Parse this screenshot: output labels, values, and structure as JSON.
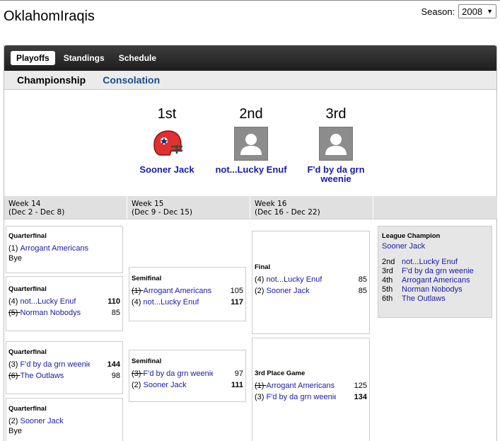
{
  "app": {
    "title": "OklahomIraqis"
  },
  "season": {
    "label": "Season:",
    "value": "2008"
  },
  "nav": {
    "tabs": [
      "Playoffs",
      "Standings",
      "Schedule"
    ]
  },
  "subnav": {
    "tabs": [
      "Championship",
      "Consolation"
    ]
  },
  "podium": [
    {
      "rank": "1st",
      "team": "Sooner Jack",
      "avatar": "helmet-icon"
    },
    {
      "rank": "2nd",
      "team": "not...Lucky Enuf",
      "avatar": "person-icon"
    },
    {
      "rank": "3rd",
      "team": "F'd by da grn weenie",
      "avatar": "person-icon"
    }
  ],
  "weeks": [
    {
      "name": "Week 14",
      "dates": "(Dec 2 - Dec 8)"
    },
    {
      "name": "Week 15",
      "dates": "(Dec 9 - Dec 15)"
    },
    {
      "name": "Week 16",
      "dates": "(Dec 16 - Dec 22)"
    }
  ],
  "matches": {
    "q1": {
      "title": "Quarterfinal",
      "seed": "(1)",
      "team": "Arrogant Americans",
      "bye": "Bye"
    },
    "q2": {
      "title": "Quarterfinal",
      "a_seed": "(4)",
      "a_team": "not...Lucky Enuf",
      "a_score": "110",
      "b_seed": "(5)",
      "b_team": "Norman Nobodys",
      "b_score": "85"
    },
    "q3": {
      "title": "Quarterfinal",
      "a_seed": "(3)",
      "a_team": "F'd by da grn weenie",
      "a_score": "144",
      "b_seed": "(6)",
      "b_team": "The Outlaws",
      "b_score": "98"
    },
    "q4": {
      "title": "Quarterfinal",
      "seed": "(2)",
      "team": "Sooner Jack",
      "bye": "Bye"
    },
    "s1": {
      "title": "Semifinal",
      "a_seed": "(1)",
      "a_team": "Arrogant Americans",
      "a_score": "105",
      "b_seed": "(4)",
      "b_team": "not...Lucky Enuf",
      "b_score": "117"
    },
    "s2": {
      "title": "Semifinal",
      "a_seed": "(3)",
      "a_team": "F'd by da grn weenie",
      "a_score": "97",
      "b_seed": "(2)",
      "b_team": "Sooner Jack",
      "b_score": "111"
    },
    "f1": {
      "title": "Final",
      "a_seed": "(4)",
      "a_team": "not...Lucky Enuf",
      "a_score": "85",
      "b_seed": "(2)",
      "b_team": "Sooner Jack",
      "b_score": "85"
    },
    "t1": {
      "title": "3rd Place Game",
      "a_seed": "(1)",
      "a_team": "Arrogant Americans",
      "a_score": "125",
      "b_seed": "(3)",
      "b_team": "F'd by da grn weenie",
      "b_score": "134"
    }
  },
  "champion": {
    "title": "League Champion",
    "winner": "Sooner Jack",
    "places": [
      {
        "rank": "2nd",
        "team": "not...Lucky Enuf"
      },
      {
        "rank": "3rd",
        "team": "F'd by da grn weenie"
      },
      {
        "rank": "4th",
        "team": "Arrogant Americans"
      },
      {
        "rank": "5th",
        "team": "Norman Nobodys"
      },
      {
        "rank": "6th",
        "team": "The Outlaws"
      }
    ]
  }
}
